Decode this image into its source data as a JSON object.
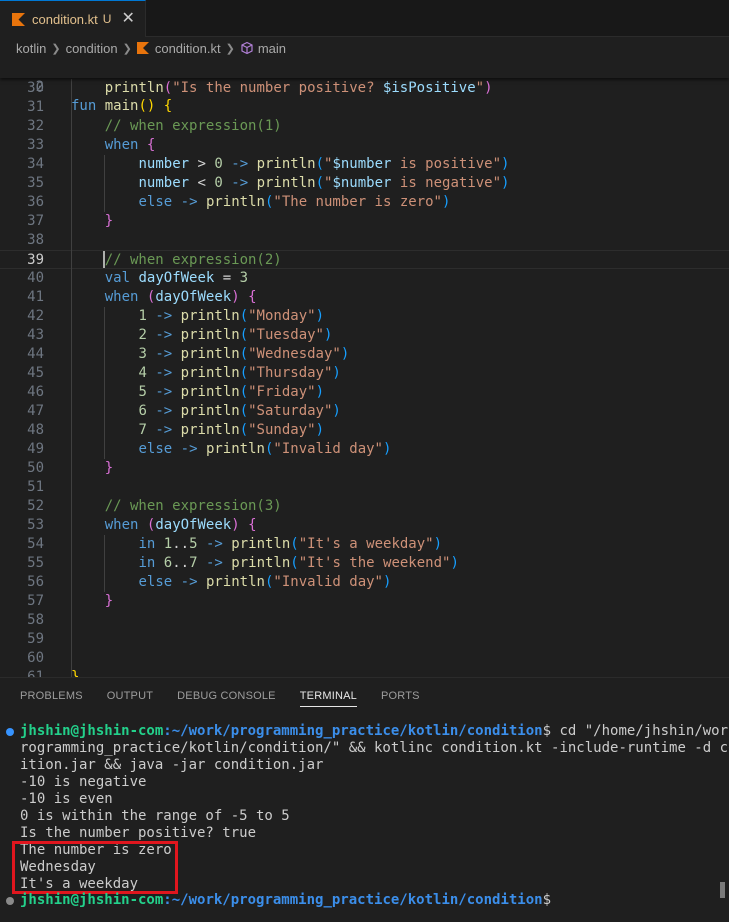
{
  "tab": {
    "filename": "condition.kt",
    "status": "U",
    "close": "✕"
  },
  "breadcrumb": {
    "items": [
      "kotlin",
      "condition",
      "condition.kt",
      "main"
    ]
  },
  "colors": {
    "accent": "#0078d4",
    "terminal_user": "#23d18b",
    "terminal_path": "#3b8eea",
    "highlight": "#e0161e"
  },
  "editor": {
    "sticky": {
      "line": "2",
      "text": "fun main() {"
    },
    "active_line": "39",
    "lines": [
      {
        "n": "30",
        "t": "    println(\"Is the number positive? $isPositive\")"
      },
      {
        "n": "31",
        "t": ""
      },
      {
        "n": "32",
        "t": "    // when expression(1)"
      },
      {
        "n": "33",
        "t": "    when {"
      },
      {
        "n": "34",
        "t": "        number > 0 -> println(\"$number is positive\")"
      },
      {
        "n": "35",
        "t": "        number < 0 -> println(\"$number is negative\")"
      },
      {
        "n": "36",
        "t": "        else -> println(\"The number is zero\")"
      },
      {
        "n": "37",
        "t": "    }"
      },
      {
        "n": "38",
        "t": ""
      },
      {
        "n": "39",
        "t": "    // when expression(2)"
      },
      {
        "n": "40",
        "t": "    val dayOfWeek = 3"
      },
      {
        "n": "41",
        "t": "    when (dayOfWeek) {"
      },
      {
        "n": "42",
        "t": "        1 -> println(\"Monday\")"
      },
      {
        "n": "43",
        "t": "        2 -> println(\"Tuesday\")"
      },
      {
        "n": "44",
        "t": "        3 -> println(\"Wednesday\")"
      },
      {
        "n": "45",
        "t": "        4 -> println(\"Thursday\")"
      },
      {
        "n": "46",
        "t": "        5 -> println(\"Friday\")"
      },
      {
        "n": "47",
        "t": "        6 -> println(\"Saturday\")"
      },
      {
        "n": "48",
        "t": "        7 -> println(\"Sunday\")"
      },
      {
        "n": "49",
        "t": "        else -> println(\"Invalid day\")"
      },
      {
        "n": "50",
        "t": "    }"
      },
      {
        "n": "51",
        "t": ""
      },
      {
        "n": "52",
        "t": "    // when expression(3)"
      },
      {
        "n": "53",
        "t": "    when (dayOfWeek) {"
      },
      {
        "n": "54",
        "t": "        in 1..5 -> println(\"It's a weekday\")"
      },
      {
        "n": "55",
        "t": "        in 6..7 -> println(\"It's the weekend\")"
      },
      {
        "n": "56",
        "t": "        else -> println(\"Invalid day\")"
      },
      {
        "n": "57",
        "t": "    }"
      },
      {
        "n": "58",
        "t": ""
      },
      {
        "n": "59",
        "t": ""
      },
      {
        "n": "60",
        "t": ""
      },
      {
        "n": "61",
        "t": "}"
      }
    ]
  },
  "panel": {
    "tabs": [
      "PROBLEMS",
      "OUTPUT",
      "DEBUG CONSOLE",
      "TERMINAL",
      "PORTS"
    ],
    "active_tab": "TERMINAL"
  },
  "terminal": {
    "prompt_user": "jhshin@jhshin-com",
    "prompt_path": ":~/work/programming_practice/kotlin/condition",
    "prompt_symbol": "$",
    "command_1": " cd \"/home/jhshin/work/p",
    "command_2": "rogramming_practice/kotlin/condition/\" && kotlinc condition.kt -include-runtime -d cond",
    "command_3": "ition.jar && java -jar condition.jar",
    "output": [
      "-10 is negative",
      "-10 is even",
      "0 is within the range of -5 to 5",
      "Is the number positive? true",
      "The number is zero",
      "Wednesday",
      "It's a weekday"
    ]
  }
}
